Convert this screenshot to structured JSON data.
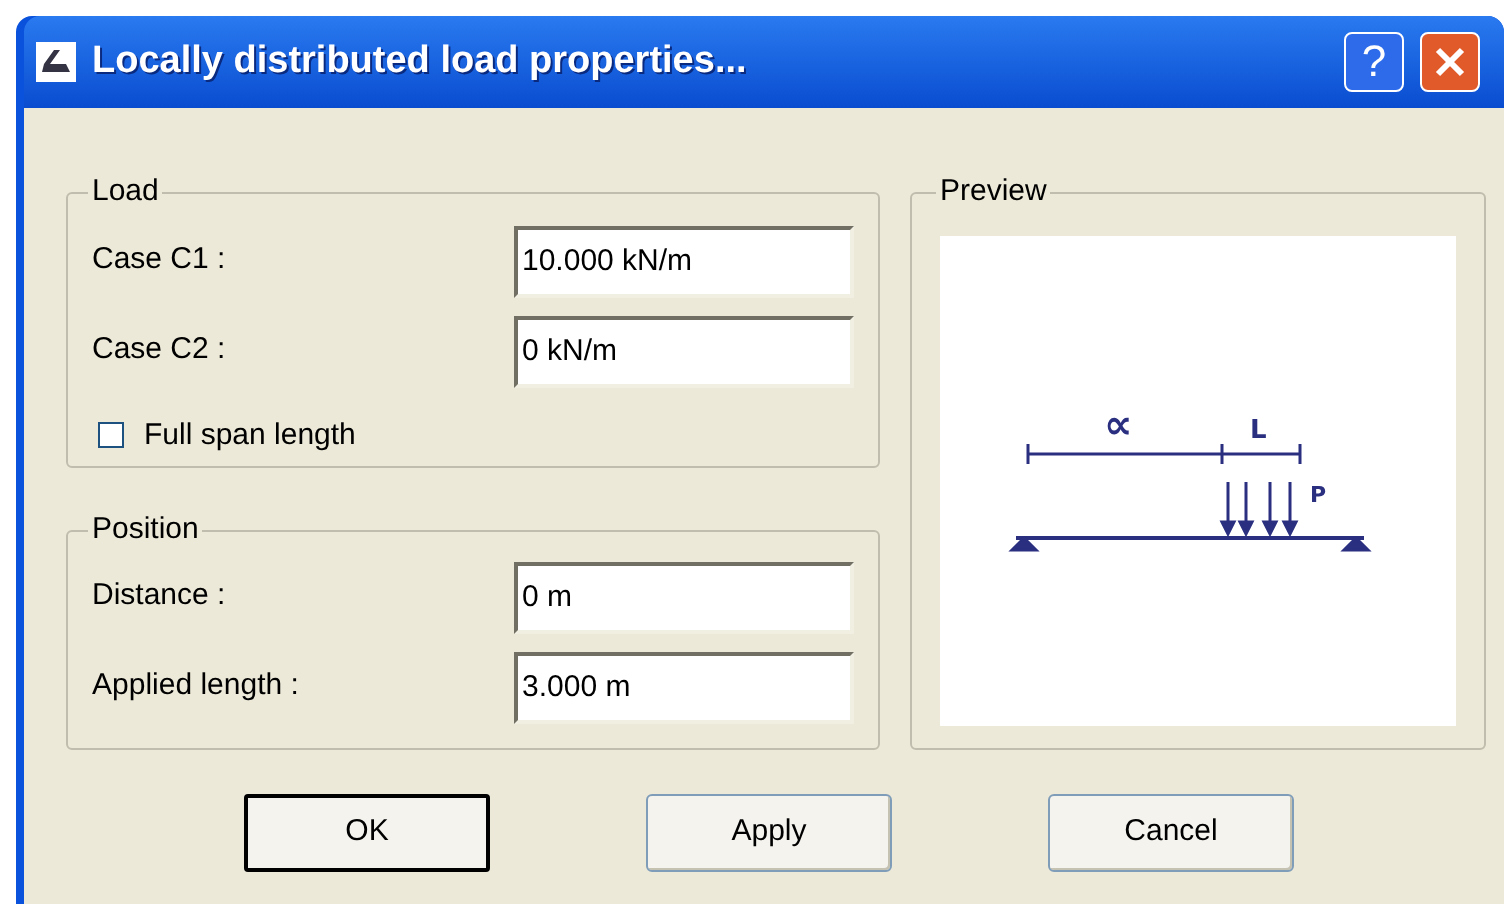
{
  "window": {
    "title": "Locally distributed load properties...",
    "help_button": "?"
  },
  "load": {
    "title": "Load",
    "fields": [
      {
        "label": "Case C1 :",
        "value": "10.000 kN/m"
      },
      {
        "label": "Case C2 :",
        "value": "0 kN/m"
      }
    ],
    "full_span": {
      "label": "Full span length",
      "checked": false
    }
  },
  "position": {
    "title": "Position",
    "fields": [
      {
        "label": "Distance :",
        "value": "0 m"
      },
      {
        "label": "Applied length :",
        "value": "3.000 m"
      }
    ]
  },
  "preview": {
    "title": "Preview",
    "labels": {
      "distance": "∝",
      "length": "L",
      "load": "P"
    }
  },
  "buttons": [
    "OK",
    "Apply",
    "Cancel"
  ]
}
